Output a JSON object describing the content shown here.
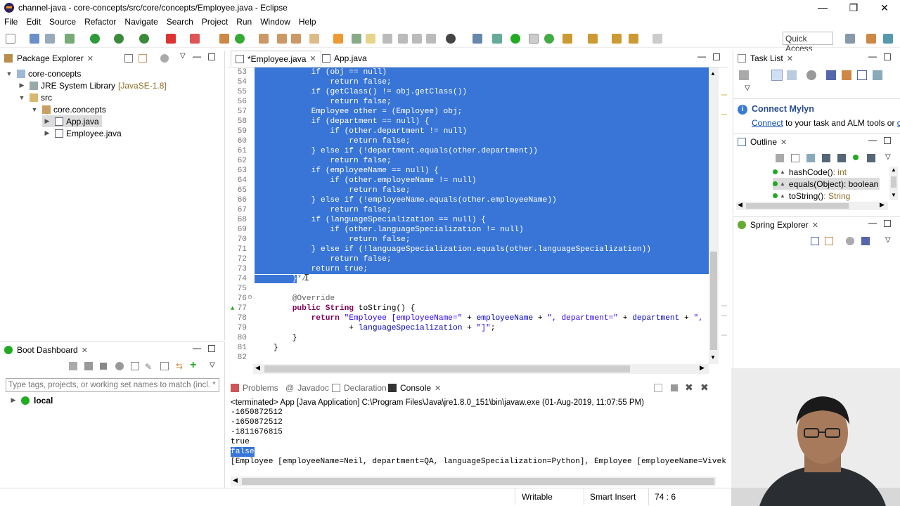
{
  "window": {
    "title": "channel-java - core-concepts/src/core/concepts/Employee.java - Eclipse",
    "minimize": "—",
    "maximize": "❐",
    "close": "✕"
  },
  "menu": [
    "File",
    "Edit",
    "Source",
    "Refactor",
    "Navigate",
    "Search",
    "Project",
    "Run",
    "Window",
    "Help"
  ],
  "quick_access": "Quick Access",
  "package_explorer": {
    "tab": "Package Explorer",
    "tree": [
      {
        "label": "core-concepts",
        "extra": ""
      },
      {
        "label": "JRE System Library",
        "extra": "[JavaSE-1.8]"
      },
      {
        "label": "src",
        "extra": ""
      },
      {
        "label": "core.concepts",
        "extra": ""
      },
      {
        "label": "App.java",
        "extra": ""
      },
      {
        "label": "Employee.java",
        "extra": ""
      }
    ]
  },
  "boot_dashboard": {
    "tab": "Boot Dashboard",
    "filter_placeholder": "Type tags, projects, or working set names to match (incl. * ar",
    "item": "local"
  },
  "editor": {
    "tabs": [
      "*Employee.java",
      "App.java"
    ],
    "lines": [
      {
        "n": "53",
        "t": "            if (obj == null)",
        "sel": true
      },
      {
        "n": "54",
        "t": "                return false;",
        "sel": true
      },
      {
        "n": "55",
        "t": "            if (getClass() != obj.getClass())",
        "sel": true
      },
      {
        "n": "56",
        "t": "                return false;",
        "sel": true
      },
      {
        "n": "57",
        "t": "            Employee other = (Employee) obj;",
        "sel": true
      },
      {
        "n": "58",
        "t": "            if (department == null) {",
        "sel": true
      },
      {
        "n": "59",
        "t": "                if (other.department != null)",
        "sel": true
      },
      {
        "n": "60",
        "t": "                    return false;",
        "sel": true
      },
      {
        "n": "61",
        "t": "            } else if (!department.equals(other.department))",
        "sel": true
      },
      {
        "n": "62",
        "t": "                return false;",
        "sel": true
      },
      {
        "n": "63",
        "t": "            if (employeeName == null) {",
        "sel": true
      },
      {
        "n": "64",
        "t": "                if (other.employeeName != null)",
        "sel": true
      },
      {
        "n": "65",
        "t": "                    return false;",
        "sel": true
      },
      {
        "n": "66",
        "t": "            } else if (!employeeName.equals(other.employeeName))",
        "sel": true
      },
      {
        "n": "67",
        "t": "                return false;",
        "sel": true
      },
      {
        "n": "68",
        "t": "            if (languageSpecialization == null) {",
        "sel": true
      },
      {
        "n": "69",
        "t": "                if (other.languageSpecialization != null)",
        "sel": true
      },
      {
        "n": "70",
        "t": "                    return false;",
        "sel": true
      },
      {
        "n": "71",
        "t": "            } else if (!languageSpecialization.equals(other.languageSpecialization))",
        "sel": true
      },
      {
        "n": "72",
        "t": "                return false;",
        "sel": true
      },
      {
        "n": "73",
        "t": "            return true;",
        "sel": true
      },
      {
        "n": "74",
        "t": "        }*/",
        "sel": "partial"
      },
      {
        "n": "75",
        "t": "",
        "sel": false
      },
      {
        "n": "76",
        "t": "        @Override",
        "sel": false
      },
      {
        "n": "77",
        "t": "        public String toString() {",
        "sel": false
      },
      {
        "n": "78",
        "t": "            return \"Employee [employeeName=\" + employeeName + \", department=\" + department + \", languag",
        "sel": false
      },
      {
        "n": "79",
        "t": "                    + languageSpecialization + \"]\";",
        "sel": false
      },
      {
        "n": "80",
        "t": "        }",
        "sel": false
      },
      {
        "n": "81",
        "t": "    }",
        "sel": false
      },
      {
        "n": "82",
        "t": "",
        "sel": false
      }
    ]
  },
  "task_list": {
    "tab": "Task List",
    "mylyn_title": "Connect Mylyn",
    "mylyn_link": "Connect",
    "mylyn_text": " to your task and ALM tools or ",
    "mylyn_more": "cre"
  },
  "outline": {
    "tab": "Outline",
    "items": [
      {
        "name": "hashCode()",
        "type": " : int"
      },
      {
        "name": "equals(Object)",
        "type": " : boolean"
      },
      {
        "name": "toString()",
        "type": " : String"
      }
    ]
  },
  "spring_explorer": {
    "tab": "Spring Explorer"
  },
  "bottom_tabs": [
    "Problems",
    "Javadoc",
    "Declaration",
    "Console"
  ],
  "console": {
    "header": "<terminated> App [Java Application] C:\\Program Files\\Java\\jre1.8.0_151\\bin\\javaw.exe (01-Aug-2019, 11:07:55 PM)",
    "lines": [
      "-1650872512",
      "-1650872512",
      "-1811676815",
      "true",
      "false",
      "[Employee [employeeName=Neil, department=QA, languageSpecialization=Python], Employee [employeeName=Vivek"
    ]
  },
  "status": {
    "writable": "Writable",
    "insert": "Smart Insert",
    "pos": "74 : 6"
  },
  "colors": {
    "selection": "#3875d7",
    "keyword": "#7f0055",
    "string": "#2a00ff",
    "field": "#0000c0"
  }
}
